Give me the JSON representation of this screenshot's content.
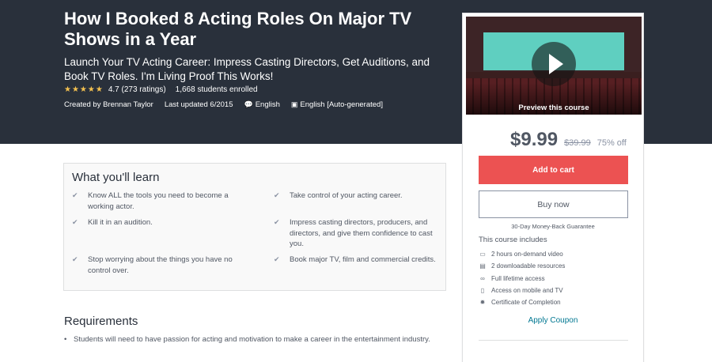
{
  "course": {
    "title": "How I Booked 8 Acting Roles On Major TV Shows in a Year",
    "subtitle": "Launch Your TV Acting Career: Impress Casting Directors, Get Auditions, and Book TV Roles. I'm Living Proof This Works!",
    "rating_value": 4.7,
    "rating_text": "4.7 (273 ratings)",
    "enrolled": "1,668 students enrolled",
    "created_by": "Created by Brennan Taylor",
    "last_updated": "Last updated 6/2015",
    "language": "English",
    "captions": "English [Auto-generated]"
  },
  "sidebar": {
    "preview_label": "Preview this course",
    "price": "$9.99",
    "original_price": "$39.99",
    "discount": "75% off",
    "add_to_cart": "Add to cart",
    "buy_now": "Buy now",
    "guarantee": "30-Day Money-Back Guarantee",
    "includes_title": "This course includes",
    "includes": [
      {
        "icon": "video-icon",
        "text": "2 hours on-demand video"
      },
      {
        "icon": "file-icon",
        "text": "2 downloadable resources"
      },
      {
        "icon": "infinity-icon",
        "text": "Full lifetime access"
      },
      {
        "icon": "mobile-icon",
        "text": "Access on mobile and TV"
      },
      {
        "icon": "trophy-icon",
        "text": "Certificate of Completion"
      }
    ],
    "apply_coupon": "Apply Coupon"
  },
  "learn": {
    "title": "What you'll learn",
    "items": [
      "Know ALL the tools you need to become a working actor.",
      "Take control of your acting career.",
      "Kill it in an audition.",
      "Impress casting directors, producers, and directors, and give them confidence to cast you.",
      "Stop worrying about the things you have no control over.",
      "Book major TV, film and commercial credits."
    ]
  },
  "requirements": {
    "title": "Requirements",
    "items": [
      "Students will need to have passion for acting and motivation to make a career in the entertainment industry."
    ]
  },
  "colors": {
    "hero_bg": "#29303b",
    "accent_red": "#ec5252",
    "star": "#f4c150",
    "link": "#007791"
  }
}
